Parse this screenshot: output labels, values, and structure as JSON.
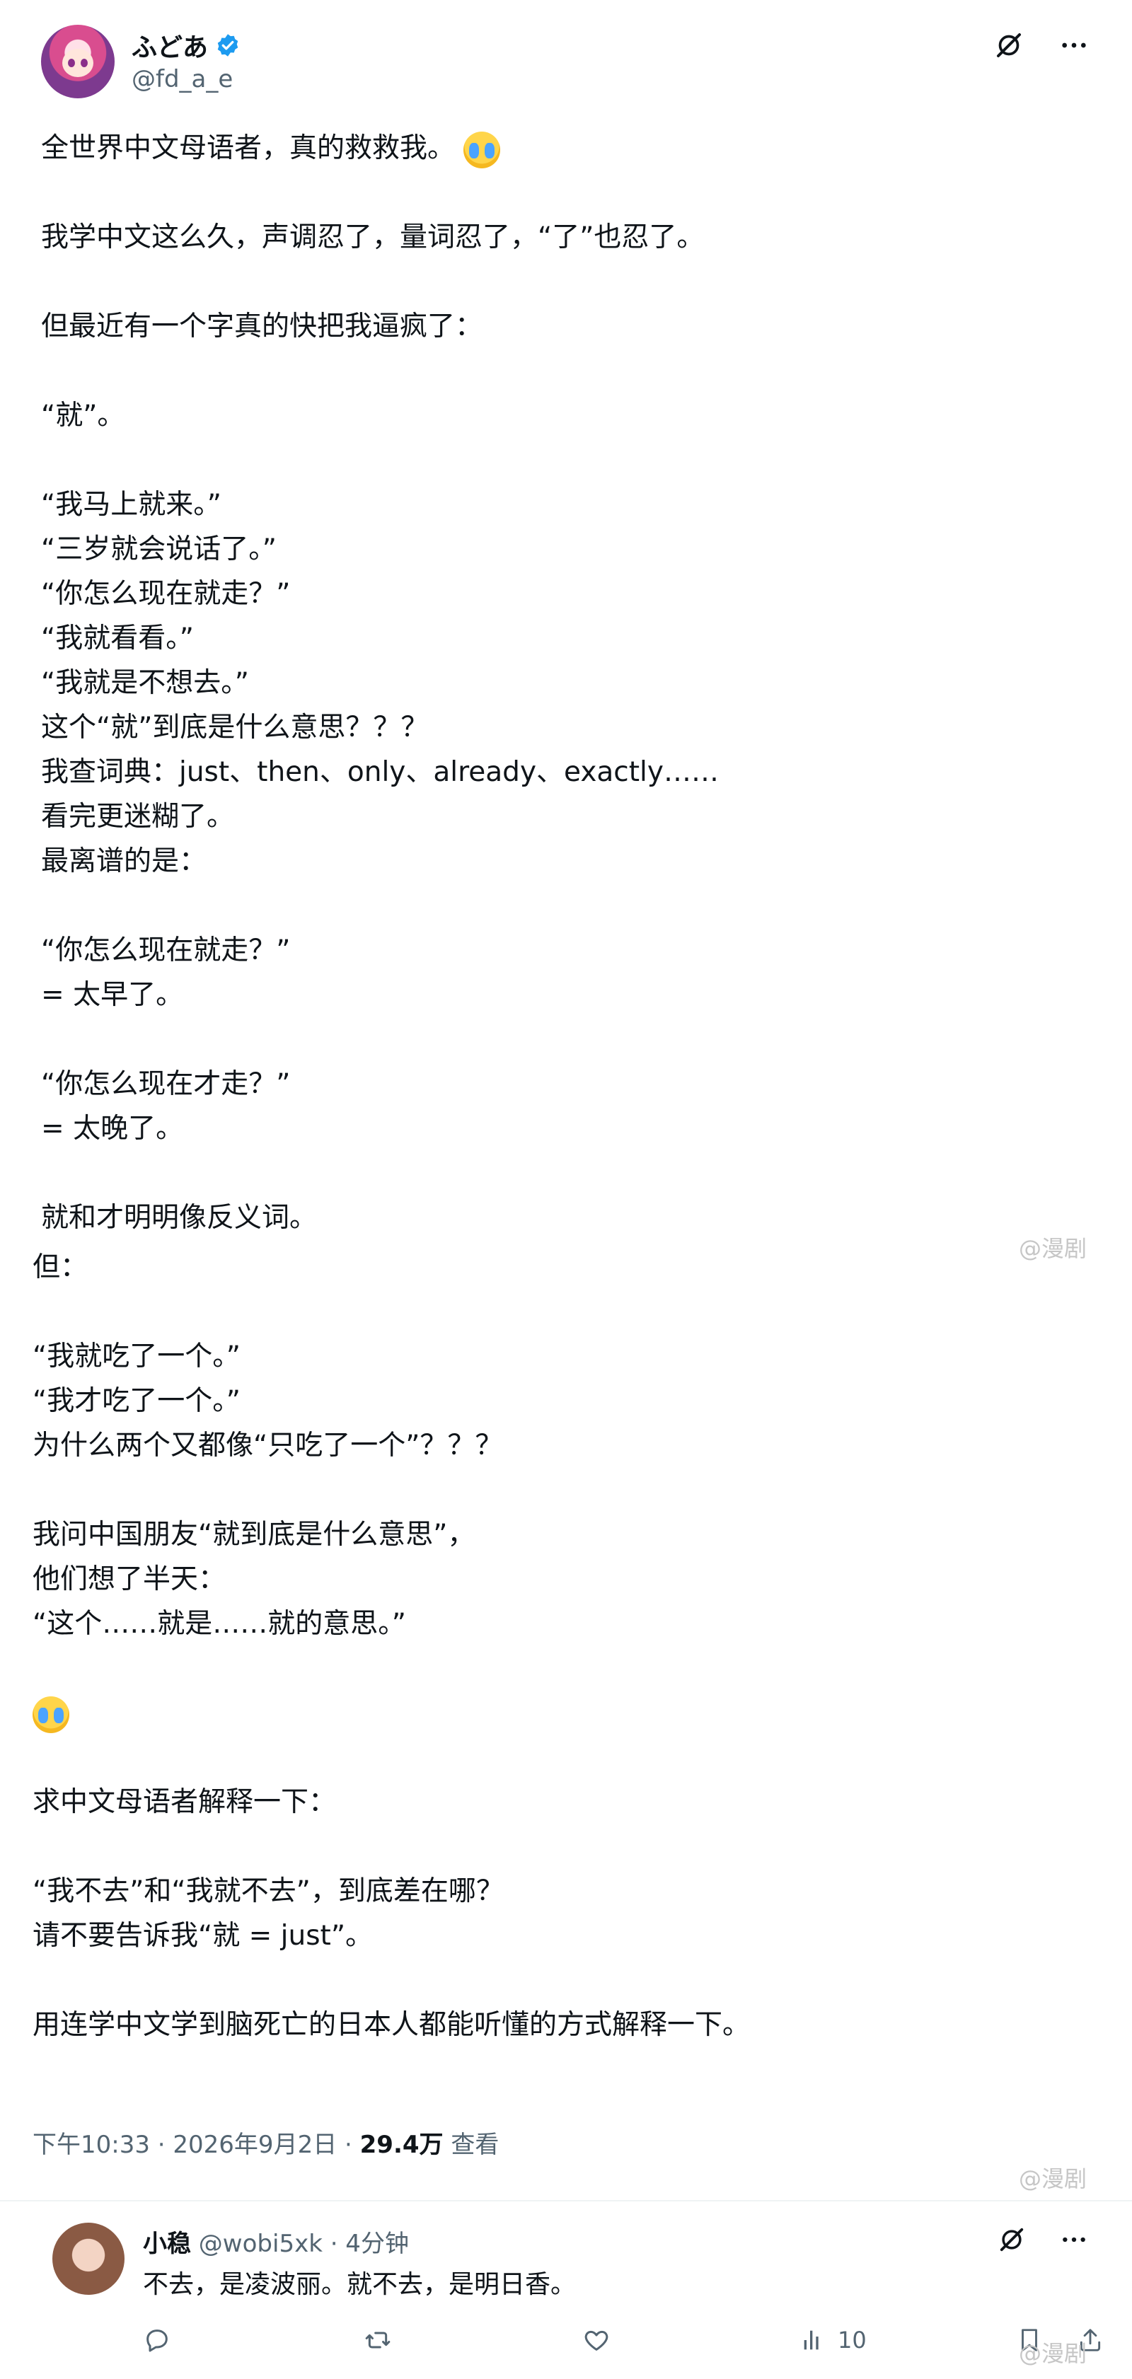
{
  "author": {
    "display_name": "ふどあ",
    "handle": "@fd_a_e",
    "verified": true
  },
  "post": {
    "lines_part1": [
      "全世界中文母语者，真的救救我。",
      "",
      "我学中文这么久，声调忍了，量词忍了，“了”也忍了。",
      "",
      "但最近有一个字真的快把我逼疯了：",
      "",
      "“就”。",
      "",
      "“我马上就来。”",
      "“三岁就会说话了。”",
      "“你怎么现在就走？”",
      "“我就看看。”",
      "“我就是不想去。”",
      "这个“就”到底是什么意思？？？",
      "我查词典：just、then、only、already、exactly……",
      "看完更迷糊了。",
      "最离谱的是：",
      "",
      "“你怎么现在就走？”",
      "= 太早了。",
      "",
      "“你怎么现在才走？”",
      "= 太晚了。",
      "",
      "就和才明明像反义词。"
    ],
    "lines_part2": [
      "但：",
      "",
      "“我就吃了一个。”",
      "“我才吃了一个。”",
      "为什么两个又都像“只吃了一个”？？？",
      "",
      "我问中国朋友“就到底是什么意思”，",
      "他们想了半天：",
      "“这个……就是……就的意思。”",
      "",
      "[emoji]",
      "",
      "求中文母语者解释一下：",
      "",
      "“我不去”和“我就不去”，到底差在哪？",
      "请不要告诉我“就 = just”。",
      "",
      "用连学中文学到脑死亡的日本人都能听懂的方式解释一下。"
    ],
    "timestamp": "下午10:33 · 2026年9月2日 · ",
    "views_count": "29.4万",
    "views_label": " 查看"
  },
  "watermarks": [
    "@漫剧",
    "@漫剧",
    "@漫剧"
  ],
  "reply": {
    "display_name": "小稳",
    "handle_meta": " @wobi5xk · 4分钟",
    "text": "不去，是凌波丽。就不去，是明日香。",
    "views_count": "10"
  },
  "icons": {
    "grok": "grok-icon",
    "more": "more-icon",
    "reply": "reply-icon",
    "repost": "repost-icon",
    "like": "like-icon",
    "views": "views-icon",
    "bookmark": "bookmark-icon",
    "share": "share-icon"
  },
  "colors": {
    "text": "#0f1419",
    "secondary": "#536471",
    "verified": "#1d9bf0"
  }
}
